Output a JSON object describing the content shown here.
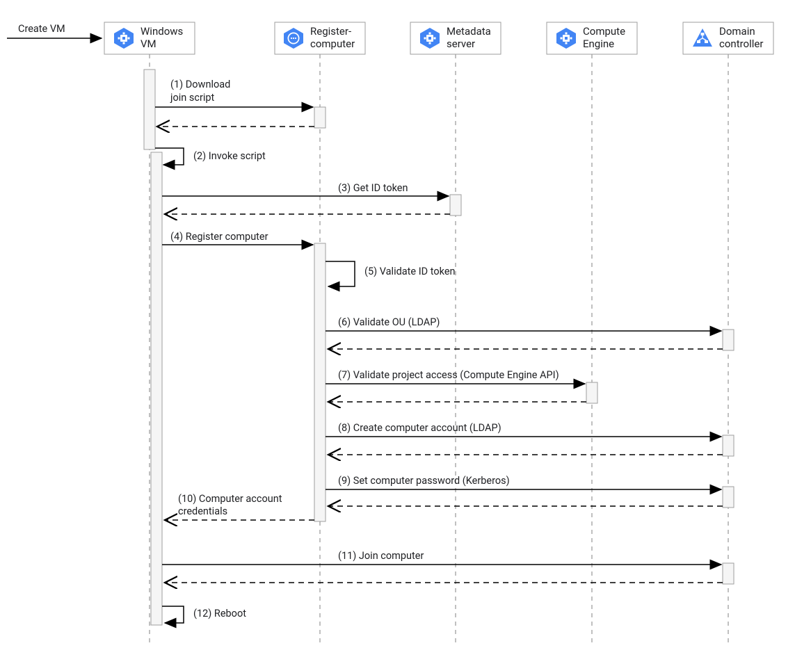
{
  "diagram": {
    "trigger": "Create VM",
    "participants": {
      "windows_vm": {
        "line1": "Windows",
        "line2": "VM",
        "icon": "hexagon-chip"
      },
      "register": {
        "line1": "Register-",
        "line2": "computer",
        "icon": "hexagon-brackets"
      },
      "metadata": {
        "line1": "Metadata",
        "line2": "server",
        "icon": "hexagon-chip"
      },
      "compute": {
        "line1": "Compute",
        "line2": "Engine",
        "icon": "hexagon-chip"
      },
      "domain_ctrl": {
        "line1": "Domain",
        "line2": "controller",
        "icon": "triangle-network"
      }
    },
    "messages": {
      "m1": "(1) Download",
      "m1b": "join script",
      "m2": "(2) Invoke script",
      "m3": "(3) Get ID token",
      "m4": "(4) Register computer",
      "m5": "(5) Validate ID token",
      "m6": "(6) Validate OU (LDAP)",
      "m7": "(7) Validate project access (Compute Engine API)",
      "m8": "(8) Create computer account (LDAP)",
      "m9": "(9) Set computer password (Kerberos)",
      "m10": "(10) Computer account",
      "m10b": "credentials",
      "m11": "(11) Join computer",
      "m12": "(12) Reboot"
    }
  },
  "chart_data": {
    "type": "sequence-diagram",
    "trigger": {
      "to": "Windows VM",
      "label": "Create VM"
    },
    "participants": [
      "Windows VM",
      "Register-computer",
      "Metadata server",
      "Compute Engine",
      "Domain controller"
    ],
    "interactions": [
      {
        "n": 1,
        "from": "Windows VM",
        "to": "Register-computer",
        "label": "Download join script",
        "return": true
      },
      {
        "n": 2,
        "from": "Windows VM",
        "to": "Windows VM",
        "label": "Invoke script",
        "return": false
      },
      {
        "n": 3,
        "from": "Windows VM",
        "to": "Metadata server",
        "label": "Get ID token",
        "return": true
      },
      {
        "n": 4,
        "from": "Windows VM",
        "to": "Register-computer",
        "label": "Register computer",
        "return": false
      },
      {
        "n": 5,
        "from": "Register-computer",
        "to": "Register-computer",
        "label": "Validate ID token",
        "return": false
      },
      {
        "n": 6,
        "from": "Register-computer",
        "to": "Domain controller",
        "label": "Validate OU (LDAP)",
        "return": true
      },
      {
        "n": 7,
        "from": "Register-computer",
        "to": "Compute Engine",
        "label": "Validate project access (Compute Engine API)",
        "return": true
      },
      {
        "n": 8,
        "from": "Register-computer",
        "to": "Domain controller",
        "label": "Create computer account (LDAP)",
        "return": true
      },
      {
        "n": 9,
        "from": "Register-computer",
        "to": "Domain controller",
        "label": "Set computer password (Kerberos)",
        "return": true
      },
      {
        "n": 10,
        "from": "Register-computer",
        "to": "Windows VM",
        "label": "Computer account credentials",
        "return": false,
        "reply": true
      },
      {
        "n": 11,
        "from": "Windows VM",
        "to": "Domain controller",
        "label": "Join computer",
        "return": true
      },
      {
        "n": 12,
        "from": "Windows VM",
        "to": "Windows VM",
        "label": "Reboot",
        "return": false
      }
    ]
  }
}
